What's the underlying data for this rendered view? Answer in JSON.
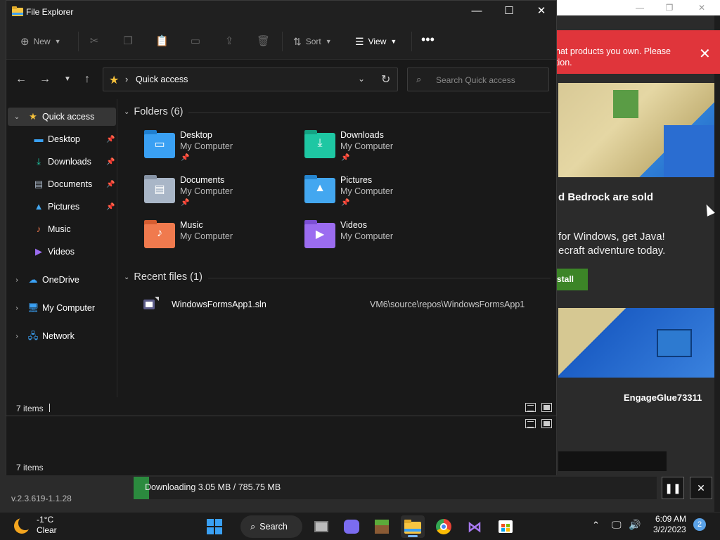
{
  "background_app": {
    "banner_text": "hat products you own. Please\ntion.",
    "heading": "d Bedrock are sold",
    "description": "for Windows, get Java!\necraft adventure today.",
    "install_label": "stall",
    "username": "EngageGlue73311",
    "version": "v.2.3.619-1.1.28",
    "banner_color": "#e0353b",
    "install_color": "#3c8527"
  },
  "download": {
    "text": "Downloading 3.05 MB / 785.75 MB",
    "progress_fraction": 0.004,
    "pause_icon": "pause-icon",
    "close_icon": "close-icon"
  },
  "explorer": {
    "title": "File Explorer",
    "toolbar": {
      "new_label": "New",
      "sort_label": "Sort",
      "view_label": "View"
    },
    "address": {
      "path": "Quick access",
      "search_placeholder": "Search Quick access"
    },
    "nav": {
      "quick_access": "Quick access",
      "pinned": [
        {
          "label": "Desktop",
          "icon": "desktop-icon",
          "pinned": true
        },
        {
          "label": "Downloads",
          "icon": "downloads-icon",
          "pinned": true
        },
        {
          "label": "Documents",
          "icon": "documents-icon",
          "pinned": true
        },
        {
          "label": "Pictures",
          "icon": "pictures-icon",
          "pinned": true
        },
        {
          "label": "Music",
          "icon": "music-icon",
          "pinned": false
        },
        {
          "label": "Videos",
          "icon": "videos-icon",
          "pinned": false
        }
      ],
      "onedrive": "OneDrive",
      "my_computer": "My Computer",
      "network": "Network"
    },
    "folders_header": "Folders (6)",
    "folders": [
      {
        "name": "Desktop",
        "location": "My Computer",
        "pinned": true,
        "color": "#3aa0f3"
      },
      {
        "name": "Downloads",
        "location": "My Computer",
        "pinned": true,
        "color": "#1ec7a3"
      },
      {
        "name": "Documents",
        "location": "My Computer",
        "pinned": true,
        "color": "#a9b6c7"
      },
      {
        "name": "Pictures",
        "location": "My Computer",
        "pinned": true,
        "color": "#43a7f0"
      },
      {
        "name": "Music",
        "location": "My Computer",
        "pinned": false,
        "color": "#f07a4e"
      },
      {
        "name": "Videos",
        "location": "My Computer",
        "pinned": false,
        "color": "#9b6cf0"
      }
    ],
    "recent_header": "Recent files (1)",
    "recent_files": [
      {
        "name": "WindowsFormsApp1.sln",
        "path": "VM6\\source\\repos\\WindowsFormsApp1"
      }
    ],
    "status_count": "7 items"
  },
  "ghost_status": "7 items",
  "taskbar": {
    "weather_temp": "-1°C",
    "weather_cond": "Clear",
    "search_label": "Search",
    "time": "6:09 AM",
    "date": "3/2/2023",
    "notifications": "2"
  }
}
